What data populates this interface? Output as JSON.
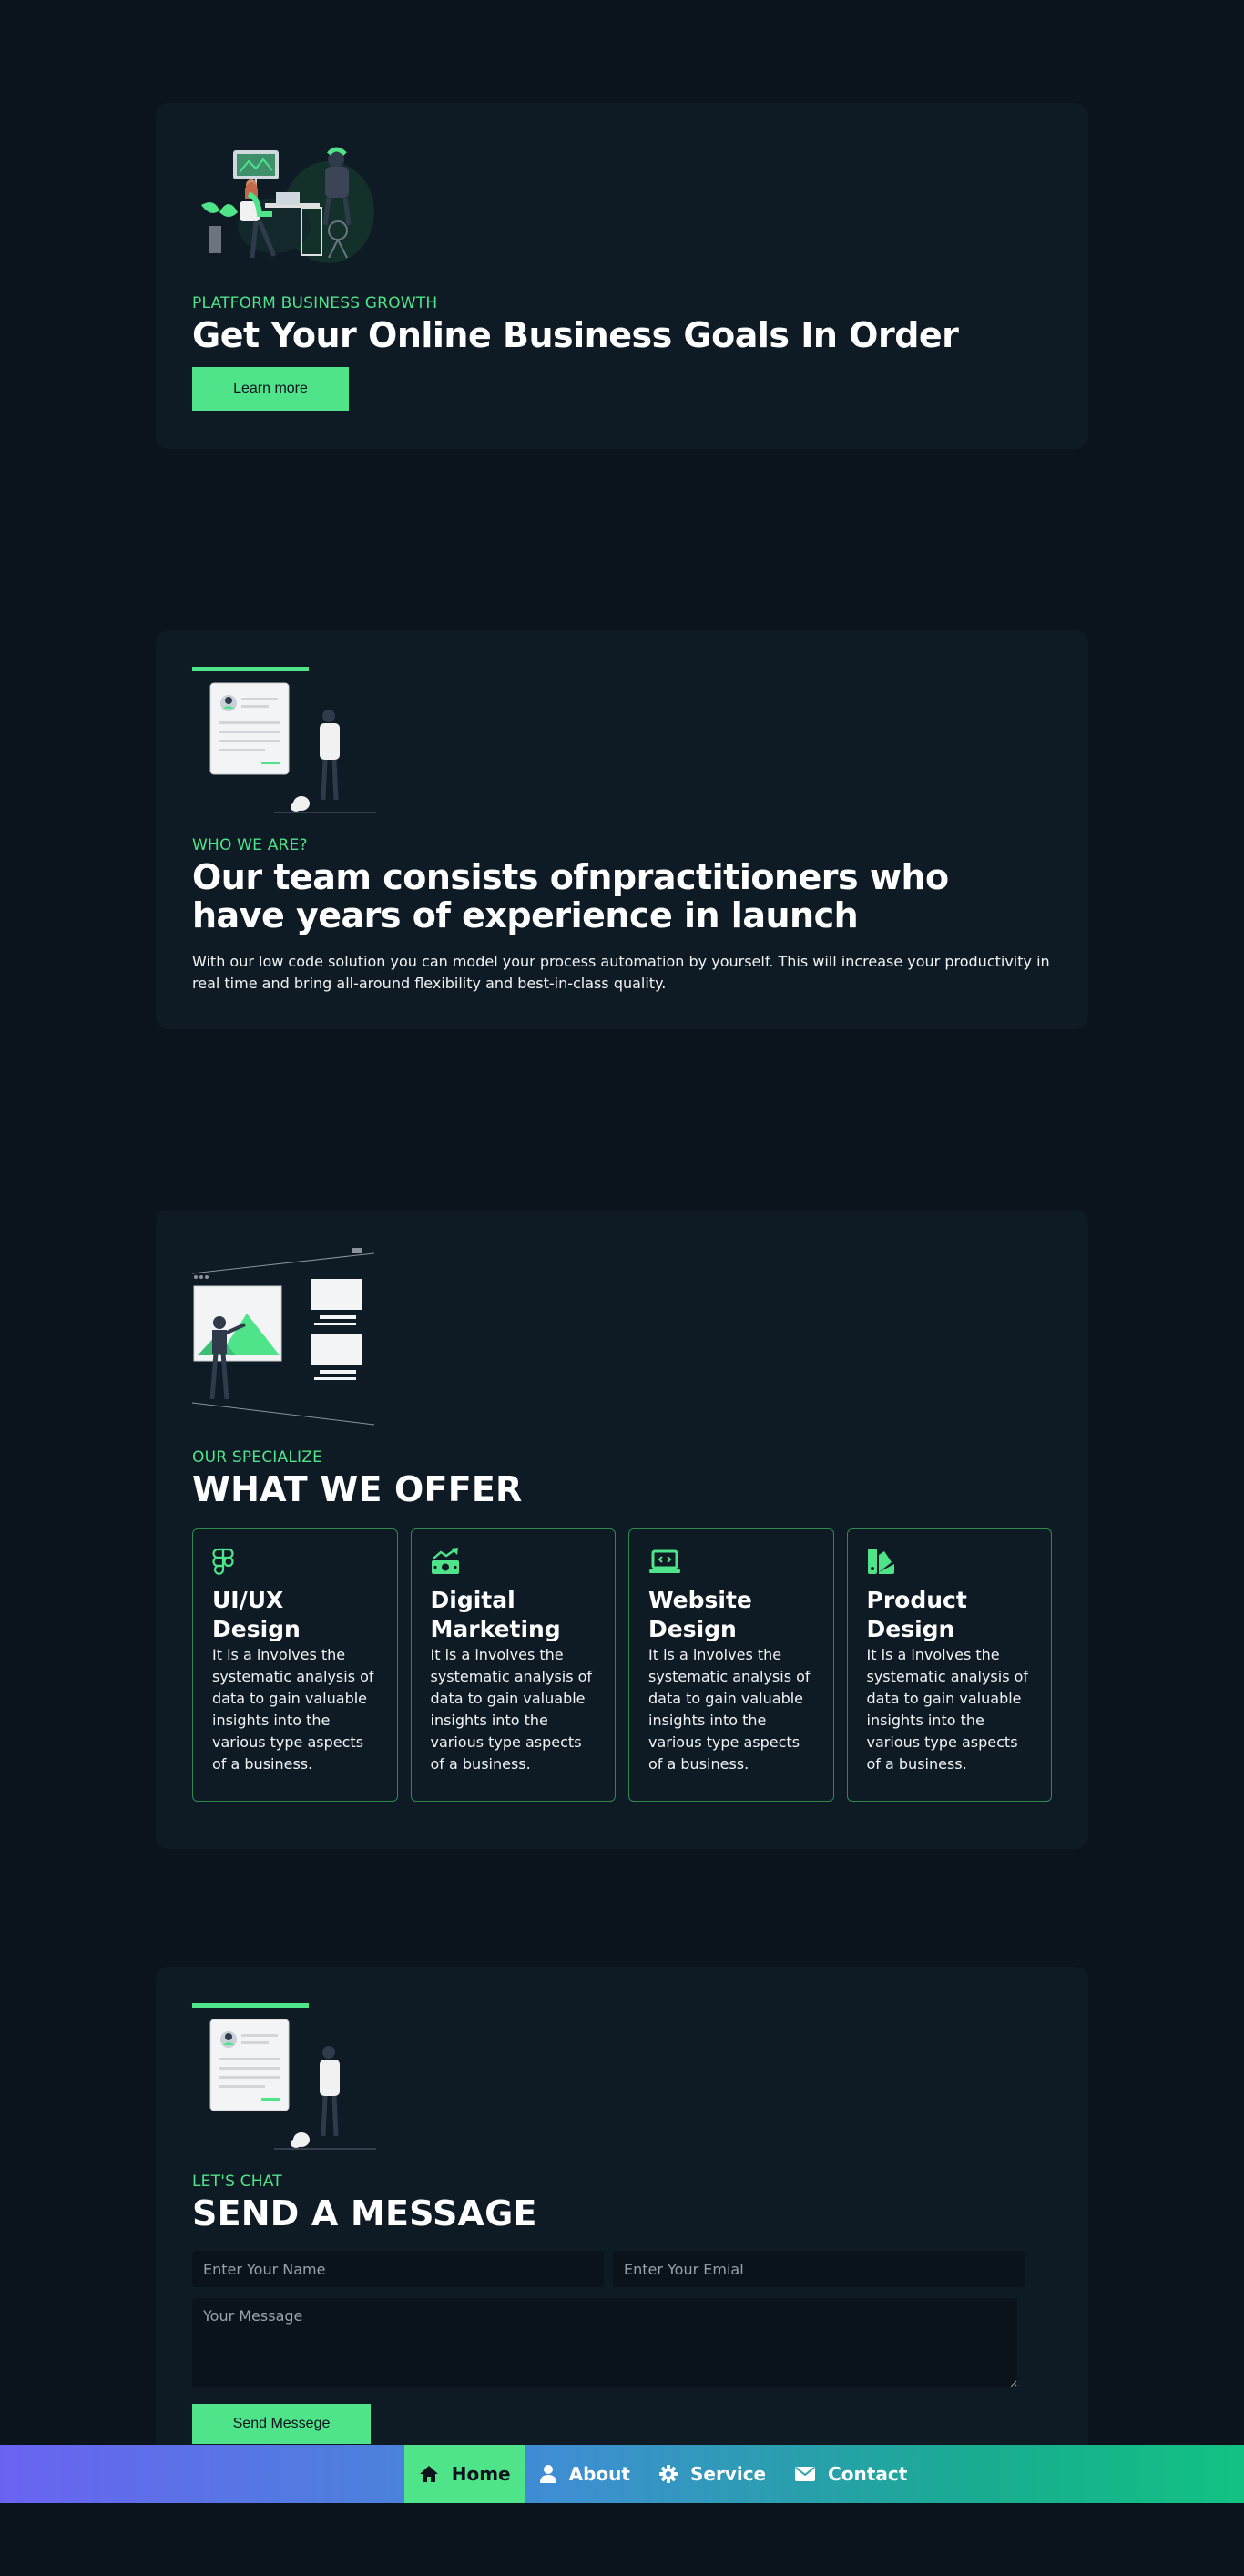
{
  "hero": {
    "eyebrow": "PLATFORM BUSINESS GROWTH",
    "title": "Get Your Online Business Goals In Order",
    "button_label": "Learn more"
  },
  "about": {
    "eyebrow": "WHO WE ARE?",
    "title": "Our team consists ofnpractitioners who have years of experience in launch",
    "text": "With our low code solution you can model your process automation by yourself. This will increase your productivity in real time and bring all-around flexibility and best-in-class quality."
  },
  "services": {
    "eyebrow": "OUR SPECIALIZE",
    "title": "WHAT WE OFFER",
    "items": [
      {
        "icon": "figma-icon",
        "title": "UI/UX Design",
        "text": "It is a involves the systematic analysis of data to gain valuable insights into the various type aspects of a business."
      },
      {
        "icon": "money-chart-icon",
        "title": "Digital Marketing",
        "text": "It is a involves the systematic analysis of data to gain valuable insights into the various type aspects of a business."
      },
      {
        "icon": "laptop-code-icon",
        "title": "Website Design",
        "text": "It is a involves the systematic analysis of data to gain valuable insights into the various type aspects of a business."
      },
      {
        "icon": "swatchbook-icon",
        "title": "Product Design",
        "text": "It is a involves the systematic analysis of data to gain valuable insights into the various type aspects of a business."
      }
    ]
  },
  "contact": {
    "eyebrow": "LET'S CHAT",
    "title": "SEND A MESSAGE",
    "name_placeholder": "Enter Your Name",
    "email_placeholder": "Enter Your Emial",
    "message_placeholder": "Your Message",
    "button_label": "Send Messege"
  },
  "nav": {
    "items": [
      {
        "icon": "home-icon",
        "label": "Home",
        "active": true
      },
      {
        "icon": "user-icon",
        "label": "About",
        "active": false
      },
      {
        "icon": "gear-icon",
        "label": "Service",
        "active": false
      },
      {
        "icon": "envelope-icon",
        "label": "Contact",
        "active": false
      }
    ]
  },
  "colors": {
    "background": "#0b131d",
    "card": "#0e1a24",
    "accent": "#4fe38a",
    "nav_gradient_start": "#6a63f2",
    "nav_gradient_end": "#12c283"
  }
}
